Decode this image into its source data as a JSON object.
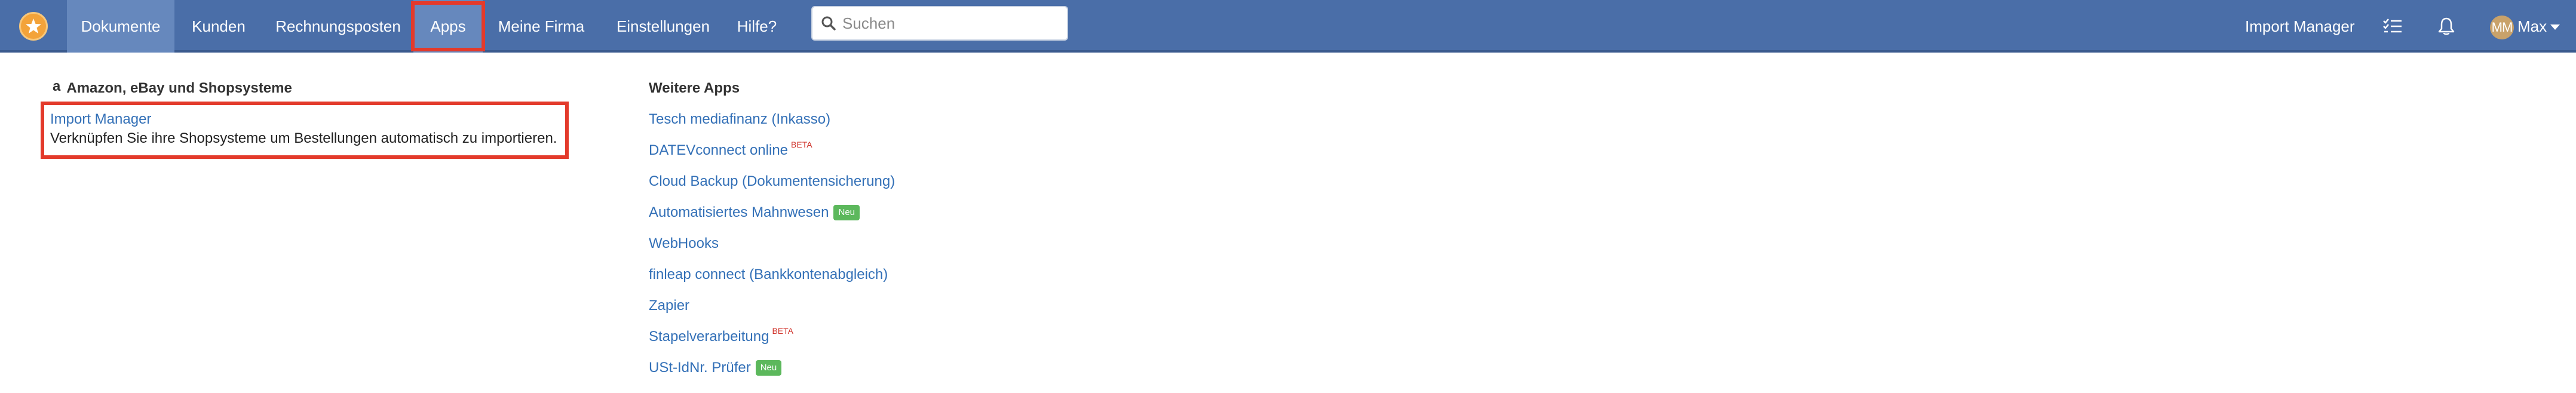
{
  "nav": {
    "items": [
      {
        "label": "Dokumente"
      },
      {
        "label": "Kunden"
      },
      {
        "label": "Rechnungsposten"
      },
      {
        "label": "Apps"
      },
      {
        "label": "Meine Firma"
      },
      {
        "label": "Einstellungen"
      },
      {
        "label": "Hilfe?"
      }
    ],
    "search_placeholder": "Suchen",
    "import_manager_label": "Import Manager",
    "user_initials": "MM",
    "user_name": "Max"
  },
  "colors": {
    "navbar_bg": "#4a6ea8",
    "link": "#3370b7",
    "highlight": "#e33a2b",
    "badge_green": "#5cb85c",
    "beta_red": "#d0342c"
  },
  "left_section": {
    "icon": "amazon-icon",
    "icon_glyph": "a",
    "title": "Amazon, eBay und Shopsysteme",
    "import_link": "Import Manager",
    "import_desc": "Verknüpfen Sie ihre Shopsysteme um Bestellungen automatisch zu importieren."
  },
  "right_section": {
    "title": "Weitere Apps",
    "apps": [
      {
        "label": "Tesch mediafinanz (Inkasso)"
      },
      {
        "label": "DATEVconnect online",
        "sup": "BETA"
      },
      {
        "label": "Cloud Backup (Dokumentensicherung)"
      },
      {
        "label": "Automatisiertes Mahnwesen",
        "badge": "Neu"
      },
      {
        "label": "WebHooks"
      },
      {
        "label": "finleap connect (Bankkontenabgleich)"
      },
      {
        "label": "Zapier"
      },
      {
        "label": "Stapelverarbeitung",
        "sup": "BETA"
      },
      {
        "label": "USt-IdNr. Prüfer",
        "badge": "Neu"
      }
    ]
  }
}
